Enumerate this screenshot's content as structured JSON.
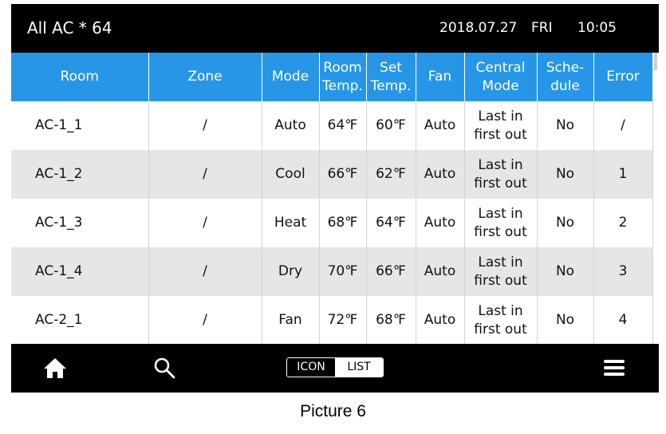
{
  "header": {
    "title": "All AC * 64",
    "date": "2018.07.27",
    "day": "FRI",
    "time": "10:05"
  },
  "table": {
    "columns": [
      {
        "line1": "Room",
        "line2": ""
      },
      {
        "line1": "Zone",
        "line2": ""
      },
      {
        "line1": "Mode",
        "line2": ""
      },
      {
        "line1": "Room",
        "line2": "Temp."
      },
      {
        "line1": "Set",
        "line2": "Temp."
      },
      {
        "line1": "Fan",
        "line2": ""
      },
      {
        "line1": "Central",
        "line2": "Mode"
      },
      {
        "line1": "Sche-",
        "line2": "dule"
      },
      {
        "line1": "Error",
        "line2": ""
      }
    ],
    "rows": [
      {
        "room": "AC-1_1",
        "zone": "/",
        "mode": "Auto",
        "room_temp": "64℉",
        "set_temp": "60℉",
        "fan": "Auto",
        "central_1": "Last in",
        "central_2": "first out",
        "schedule": "No",
        "error": "/"
      },
      {
        "room": "AC-1_2",
        "zone": "/",
        "mode": "Cool",
        "room_temp": "66℉",
        "set_temp": "62℉",
        "fan": "Auto",
        "central_1": "Last in",
        "central_2": "first out",
        "schedule": "No",
        "error": "1"
      },
      {
        "room": "AC-1_3",
        "zone": "/",
        "mode": "Heat",
        "room_temp": "68℉",
        "set_temp": "64℉",
        "fan": "Auto",
        "central_1": "Last in",
        "central_2": "first out",
        "schedule": "No",
        "error": "2"
      },
      {
        "room": "AC-1_4",
        "zone": "/",
        "mode": "Dry",
        "room_temp": "70℉",
        "set_temp": "66℉",
        "fan": "Auto",
        "central_1": "Last in",
        "central_2": "first out",
        "schedule": "No",
        "error": "3"
      },
      {
        "room": "AC-2_1",
        "zone": "/",
        "mode": "Fan",
        "room_temp": "72℉",
        "set_temp": "68℉",
        "fan": "Auto",
        "central_1": "Last in",
        "central_2": "first out",
        "schedule": "No",
        "error": "4"
      }
    ]
  },
  "footer": {
    "icons": [
      "home-icon",
      "search-icon",
      "menu-icon"
    ],
    "toggle": {
      "icon_label": "ICON",
      "list_label": "LIST",
      "active": "LIST"
    }
  },
  "colors": {
    "header_bg": "#000000",
    "table_header_bg": "#2796e6",
    "alt_row_bg": "#e6e6e6",
    "text": "#111111"
  },
  "caption": "Picture 6"
}
